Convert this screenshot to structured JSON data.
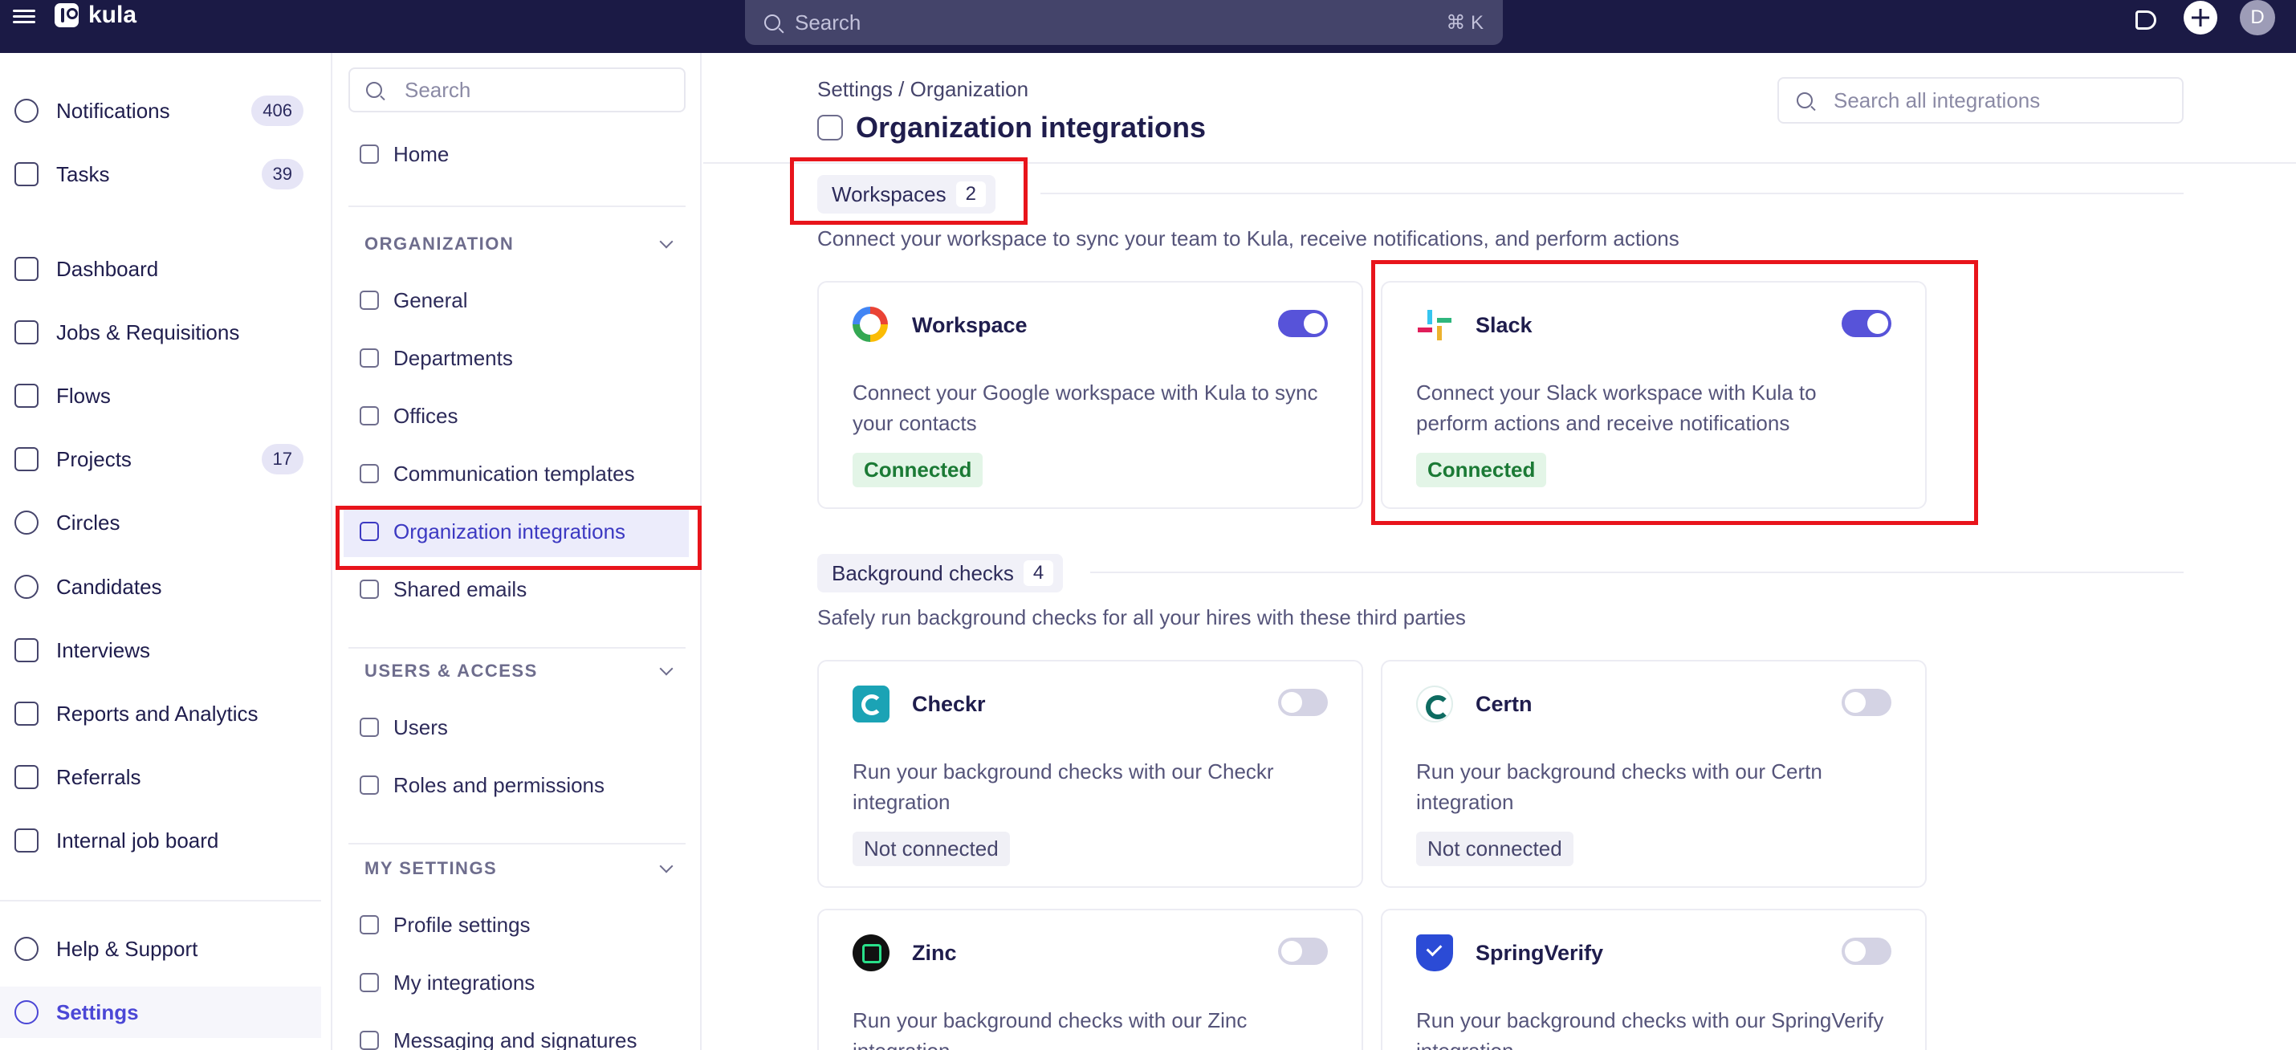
{
  "app": {
    "name": "kula",
    "search_placeholder": "Search",
    "search_shortcut": "⌘ K",
    "avatar_initial": "D"
  },
  "sidebar": {
    "items": [
      {
        "label": "Notifications",
        "badge": "406",
        "icon": "bell-icon"
      },
      {
        "label": "Tasks",
        "badge": "39",
        "icon": "calendar-check-icon"
      },
      {
        "label": "Dashboard",
        "icon": "home-icon"
      },
      {
        "label": "Jobs & Requisitions",
        "icon": "layers-icon"
      },
      {
        "label": "Flows",
        "icon": "send-icon"
      },
      {
        "label": "Projects",
        "badge": "17",
        "icon": "folder-icon"
      },
      {
        "label": "Circles",
        "icon": "circles-icon"
      },
      {
        "label": "Candidates",
        "icon": "user-circle-icon"
      },
      {
        "label": "Interviews",
        "icon": "audio-lines-icon"
      },
      {
        "label": "Reports and Analytics",
        "icon": "chart-icon"
      },
      {
        "label": "Referrals",
        "icon": "user-plus-icon"
      },
      {
        "label": "Internal job board",
        "icon": "inbox-icon"
      }
    ],
    "footer": [
      {
        "label": "Help & Support",
        "icon": "help-icon"
      },
      {
        "label": "Settings",
        "icon": "gear-icon"
      }
    ]
  },
  "settings_nav": {
    "search_placeholder": "Search",
    "home": "Home",
    "org_header": "ORGANIZATION",
    "org_items": [
      "General",
      "Departments",
      "Offices",
      "Communication templates",
      "Organization integrations",
      "Shared emails"
    ],
    "users_header": "USERS & ACCESS",
    "users_items": [
      "Users",
      "Roles and permissions"
    ],
    "my_header": "MY SETTINGS",
    "my_items": [
      "Profile settings",
      "My integrations",
      "Messaging and signatures"
    ]
  },
  "main": {
    "breadcrumb": "Settings / Organization",
    "title": "Organization integrations",
    "search_placeholder": "Search all integrations",
    "sections": [
      {
        "name": "Workspaces",
        "count": "2",
        "description": "Connect your workspace to sync your team to Kula, receive notifications, and perform actions",
        "cards": [
          {
            "name": "Workspace",
            "description": "Connect your Google workspace with Kula to sync your contacts",
            "status": "Connected",
            "enabled": true,
            "logo": "google-logo-icon"
          },
          {
            "name": "Slack",
            "description": "Connect your Slack workspace with Kula to perform actions and receive notifications",
            "status": "Connected",
            "enabled": true,
            "logo": "slack-logo-icon"
          }
        ]
      },
      {
        "name": "Background checks",
        "count": "4",
        "description": "Safely run background checks for all your hires with these third parties",
        "cards": [
          {
            "name": "Checkr",
            "description": "Run your background checks with our Checkr integration",
            "status": "Not connected",
            "enabled": false,
            "logo": "checkr-logo-icon"
          },
          {
            "name": "Certn",
            "description": "Run your background checks with our Certn integration",
            "status": "Not connected",
            "enabled": false,
            "logo": "certn-logo-icon"
          },
          {
            "name": "Zinc",
            "description": "Run your background checks with our Zinc integration",
            "status": "",
            "enabled": false,
            "logo": "zinc-logo-icon"
          },
          {
            "name": "SpringVerify",
            "description": "Run your background checks with our SpringVerify integration",
            "status": "",
            "enabled": false,
            "logo": "springverify-logo-icon"
          }
        ]
      }
    ]
  },
  "colors": {
    "topbar": "#1b1a45",
    "accent": "#5753d9",
    "highlight": "#e8141b",
    "connected_bg": "#e3f5e7",
    "connected_text": "#1b7a35"
  }
}
